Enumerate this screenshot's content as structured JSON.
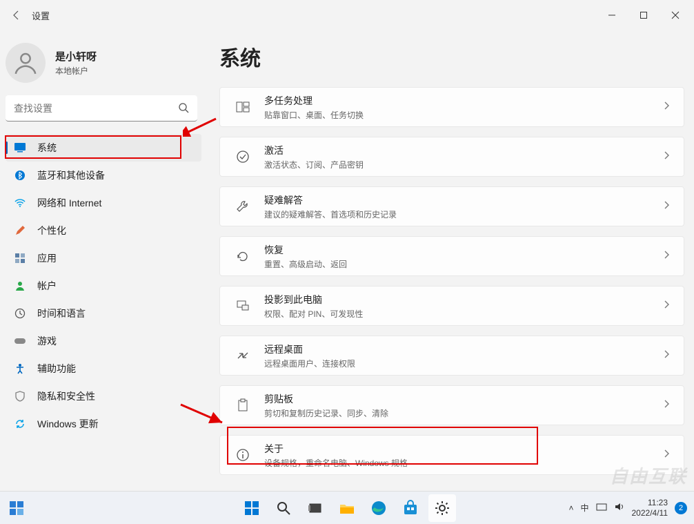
{
  "window": {
    "title": "设置"
  },
  "user": {
    "name": "是小轩呀",
    "account_type": "本地帐户"
  },
  "search": {
    "placeholder": "查找设置"
  },
  "sidebar": {
    "items": [
      {
        "label": "系统",
        "icon": "display-icon",
        "color": "#0078d4",
        "selected": true
      },
      {
        "label": "蓝牙和其他设备",
        "icon": "bluetooth-icon",
        "color": "#0078d4"
      },
      {
        "label": "网络和 Internet",
        "icon": "wifi-icon",
        "color": "#0aa3e8"
      },
      {
        "label": "个性化",
        "icon": "brush-icon",
        "color": "#e0683c"
      },
      {
        "label": "应用",
        "icon": "apps-icon",
        "color": "#5b7fa6"
      },
      {
        "label": "帐户",
        "icon": "person-icon",
        "color": "#2aa84a"
      },
      {
        "label": "时间和语言",
        "icon": "clock-lang-icon",
        "color": "#555"
      },
      {
        "label": "游戏",
        "icon": "gamepad-icon",
        "color": "#888"
      },
      {
        "label": "辅助功能",
        "icon": "accessibility-icon",
        "color": "#0067c0"
      },
      {
        "label": "隐私和安全性",
        "icon": "shield-icon",
        "color": "#888"
      },
      {
        "label": "Windows 更新",
        "icon": "update-icon",
        "color": "#0aa3e8"
      }
    ]
  },
  "main": {
    "heading": "系统",
    "cards": [
      {
        "title": "多任务处理",
        "subtitle": "贴靠窗口、桌面、任务切换",
        "icon": "multitask-icon"
      },
      {
        "title": "激活",
        "subtitle": "激活状态、订阅、产品密钥",
        "icon": "check-circle-icon"
      },
      {
        "title": "疑难解答",
        "subtitle": "建议的疑难解答、首选项和历史记录",
        "icon": "wrench-icon"
      },
      {
        "title": "恢复",
        "subtitle": "重置、高级启动、返回",
        "icon": "recovery-icon"
      },
      {
        "title": "投影到此电脑",
        "subtitle": "权限、配对 PIN、可发现性",
        "icon": "project-icon"
      },
      {
        "title": "远程桌面",
        "subtitle": "远程桌面用户、连接权限",
        "icon": "remote-icon"
      },
      {
        "title": "剪贴板",
        "subtitle": "剪切和复制历史记录、同步、清除",
        "icon": "clipboard-icon"
      },
      {
        "title": "关于",
        "subtitle": "设备规格，重命名电脑、Windows 规格",
        "icon": "info-icon"
      }
    ]
  },
  "taskbar": {
    "tray": {
      "chevron": "˄",
      "ime": "中",
      "time": "11:23",
      "date": "2022/4/11",
      "notif_count": "2"
    }
  },
  "watermark": "自由互联"
}
